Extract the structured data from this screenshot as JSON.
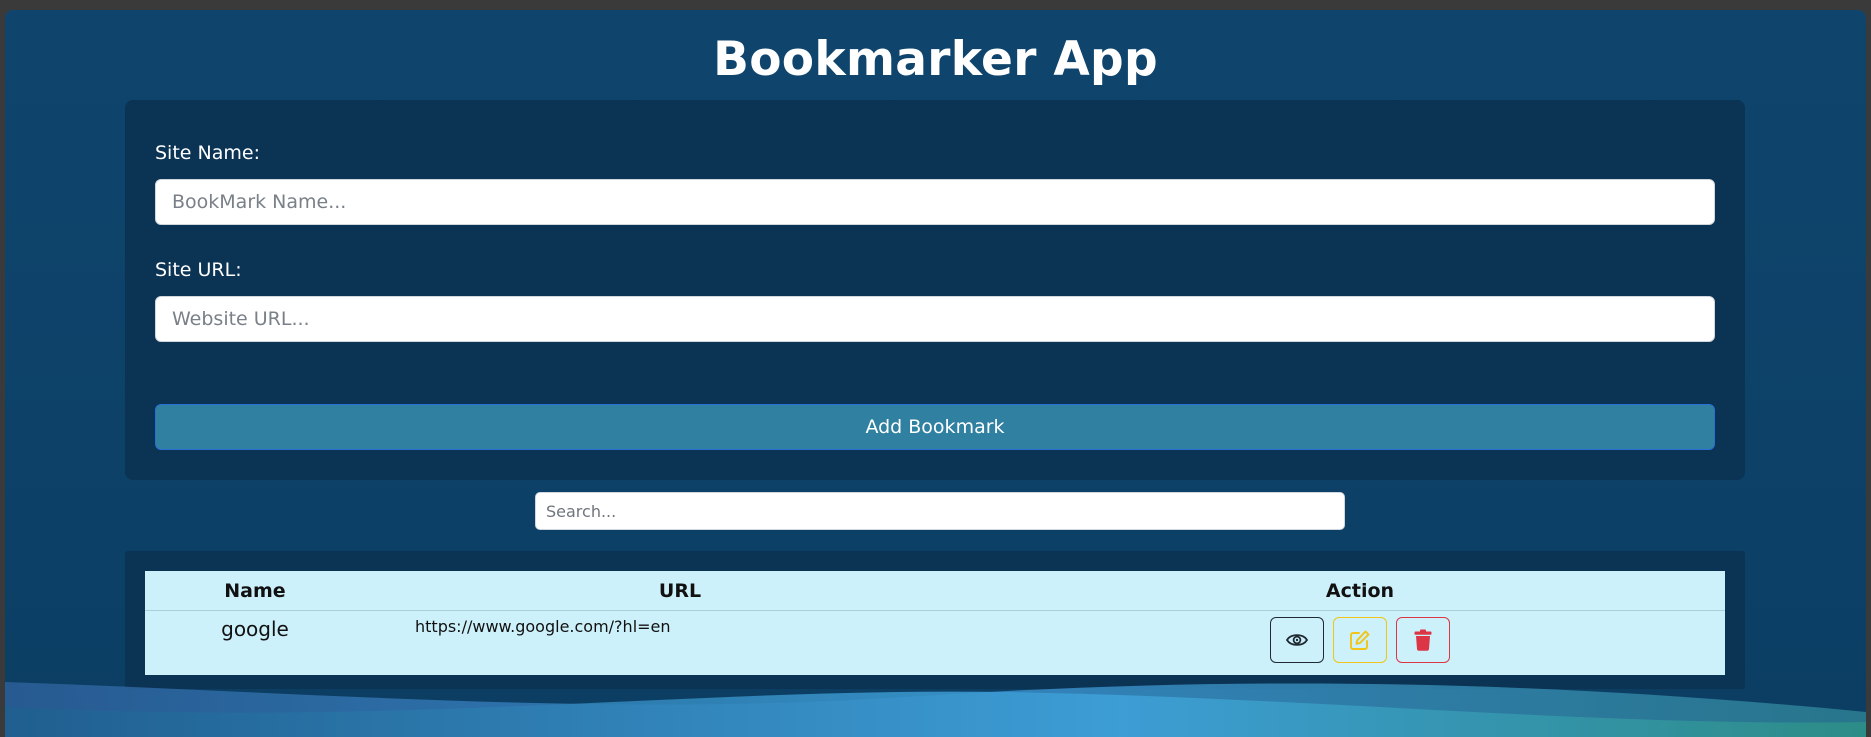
{
  "app": {
    "title": "Bookmarker App"
  },
  "form": {
    "site_name_label": "Site Name:",
    "site_name_placeholder": "BookMark Name...",
    "site_url_label": "Site URL:",
    "site_url_placeholder": "Website URL...",
    "add_button_label": "Add Bookmark"
  },
  "search": {
    "placeholder": "Search..."
  },
  "table": {
    "headers": [
      "Name",
      "URL",
      "Action"
    ],
    "rows": [
      {
        "name": "google",
        "url": "https://www.google.com/?hl=en",
        "actions": [
          {
            "icon": "eye-icon",
            "color": "#1f2a33"
          },
          {
            "icon": "edit-icon",
            "color": "#f2c417"
          },
          {
            "icon": "trash-icon",
            "color": "#dc3545"
          }
        ]
      }
    ]
  },
  "colors": {
    "background": "#0f456d",
    "card": "#0b3354",
    "button": "#2f80a1",
    "table_row": "#cdf1fa"
  }
}
